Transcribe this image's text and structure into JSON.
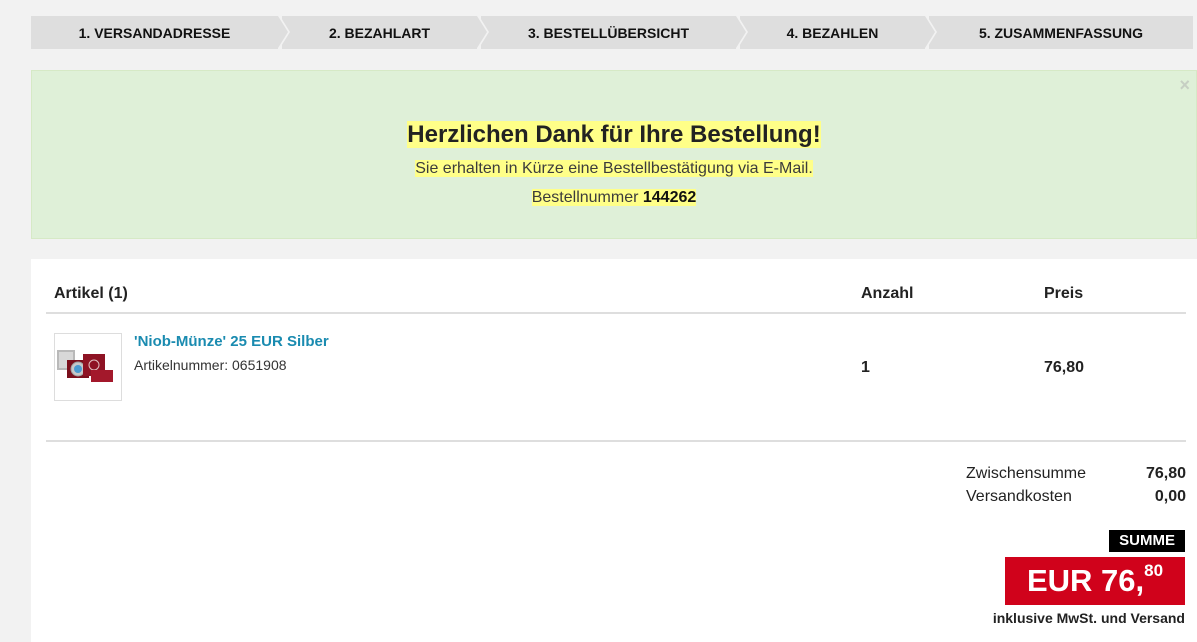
{
  "steps": [
    {
      "label": "1. VERSANDADRESSE"
    },
    {
      "label": "2. BEZAHLART"
    },
    {
      "label": "3. BESTELLÜBERSICHT"
    },
    {
      "label": "4. BEZAHLEN"
    },
    {
      "label": "5. ZUSAMMENFASSUNG"
    }
  ],
  "alert": {
    "close": "×",
    "title": "Herzlichen Dank für Ihre Bestellung!",
    "message": "Sie erhalten in Kürze eine Bestellbestätigung via E-Mail.",
    "order_label": "Bestellnummer",
    "order_number": "144262"
  },
  "table": {
    "col_article": "Artikel (1)",
    "col_qty": "Anzahl",
    "col_price": "Preis"
  },
  "item": {
    "name": "'Niob-Münze' 25 EUR Silber",
    "article_number": "Artikelnummer: 0651908",
    "quantity": "1",
    "price": "76,80"
  },
  "totals": {
    "subtotal_label": "Zwischensumme",
    "subtotal_value": "76,80",
    "shipping_label": "Versandkosten",
    "shipping_value": "0,00",
    "sum_label": "SUMME",
    "sum_main": "EUR 76,",
    "sum_cents": "80",
    "incl_note": "inklusive MwSt. und Versand"
  },
  "colors": {
    "accent_red": "#d0021b",
    "link_blue": "#1a8bb0",
    "success_bg": "#dff0d8",
    "highlight": "#ffff88"
  }
}
